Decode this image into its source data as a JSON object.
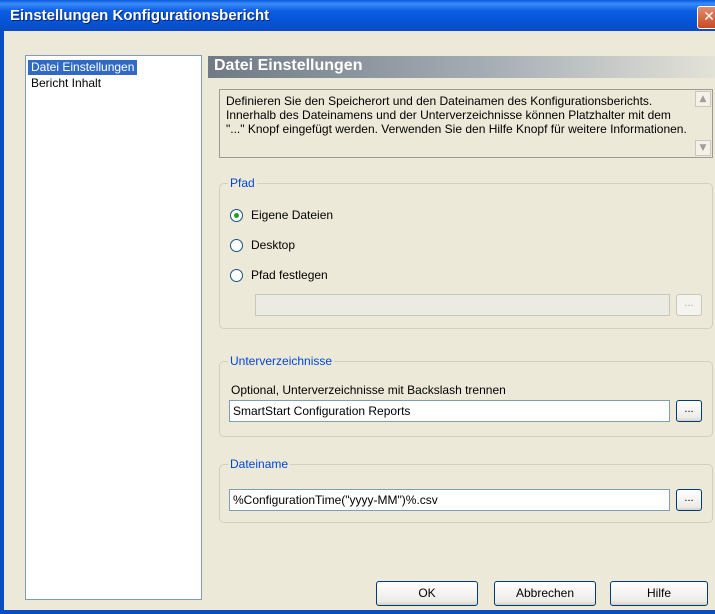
{
  "window": {
    "title": "Einstellungen Konfigurationsbericht",
    "close_glyph": "✕"
  },
  "nav": {
    "items": [
      {
        "label": "Datei Einstellungen",
        "selected": true
      },
      {
        "label": "Bericht Inhalt",
        "selected": false
      }
    ]
  },
  "page": {
    "header": "Datei Einstellungen",
    "description": "Definieren Sie den Speicherort und den Dateinamen des Konfigurationsberichts. Innerhalb des Dateinamens und der Unterverzeichnisse können Platzhalter mit dem \"...\" Knopf eingefügt werden. Verwenden Sie den Hilfe Knopf für weitere Informationen."
  },
  "pfad": {
    "title": "Pfad",
    "options": [
      {
        "label": "Eigene Dateien",
        "checked": true
      },
      {
        "label": "Desktop",
        "checked": false
      },
      {
        "label": "Pfad festlegen",
        "checked": false
      }
    ],
    "custom_path_value": "",
    "browse_label": "..."
  },
  "unterverzeichnisse": {
    "title": "Unterverzeichnisse",
    "hint": "Optional, Unterverzeichnisse mit Backslash trennen",
    "value": "SmartStart Configuration Reports",
    "browse_label": "..."
  },
  "dateiname": {
    "title": "Dateiname",
    "value": "%ConfigurationTime(\"yyyy-MM\")%.csv",
    "browse_label": "..."
  },
  "buttons": {
    "ok": "OK",
    "cancel": "Abbrechen",
    "help": "Hilfe"
  },
  "colors": {
    "title_bar": "#0554d6",
    "group_title": "#0046d5",
    "selection": "#316ac5",
    "dialog_bg": "#ece9d8"
  },
  "icons": {
    "scroll_up": "chevron-up-icon",
    "scroll_down": "chevron-down-icon",
    "close": "close-icon"
  }
}
